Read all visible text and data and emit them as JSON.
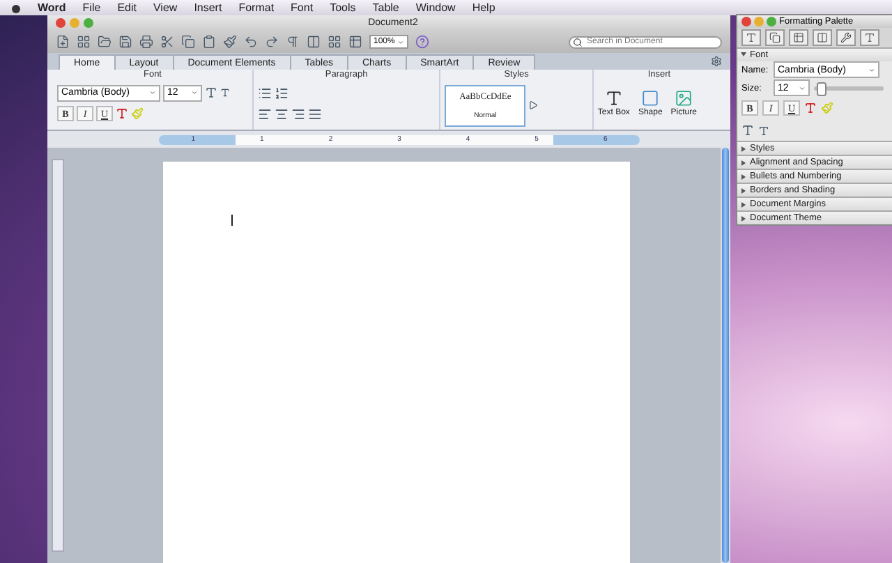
{
  "menu_bar": {
    "app": "Word",
    "items": [
      "File",
      "Edit",
      "View",
      "Insert",
      "Format",
      "Font",
      "Tools",
      "Table",
      "Window",
      "Help"
    ]
  },
  "window": {
    "title": "Document2"
  },
  "toolbar": {
    "zoom": "100%",
    "search": {
      "placeholder": "Search in Document"
    }
  },
  "ribbon_tabs": [
    {
      "label": "Home",
      "selected": true
    },
    {
      "label": "Layout",
      "selected": false
    },
    {
      "label": "Document Elements",
      "selected": false
    },
    {
      "label": "Tables",
      "selected": false
    },
    {
      "label": "Charts",
      "selected": false
    },
    {
      "label": "SmartArt",
      "selected": false
    },
    {
      "label": "Review",
      "selected": false
    }
  ],
  "ribbon": {
    "font_group": "Font",
    "font_name": "Cambria (Body)",
    "font_size": "12",
    "format_buttons": [
      "B",
      "I",
      "U"
    ],
    "paragraph_group": "Paragraph",
    "styles_group": "Styles",
    "style_preview": "AaBbCcDdEe",
    "style_name": "Normal",
    "insert_group": "Insert",
    "insert_items": [
      "Text Box",
      "Shape",
      "Picture"
    ]
  },
  "ruler_marks": [
    "1",
    "1",
    "2",
    "3",
    "4",
    "5",
    "6"
  ],
  "palette": {
    "title": "Formatting Palette",
    "font_section": {
      "label": "Font",
      "expanded": true
    },
    "name_label": "Name:",
    "name_value": "Cambria (Body)",
    "size_label": "Size:",
    "size_value": "12",
    "size_slider": {
      "level": 0.05
    },
    "format_buttons": [
      "B",
      "I",
      "U"
    ],
    "sections": [
      {
        "label": "Styles",
        "expanded": false
      },
      {
        "label": "Alignment and Spacing",
        "expanded": false
      },
      {
        "label": "Bullets and Numbering",
        "expanded": false
      },
      {
        "label": "Borders and Shading",
        "expanded": false
      },
      {
        "label": "Document Margins",
        "expanded": false
      },
      {
        "label": "Document Theme",
        "expanded": false
      }
    ]
  }
}
